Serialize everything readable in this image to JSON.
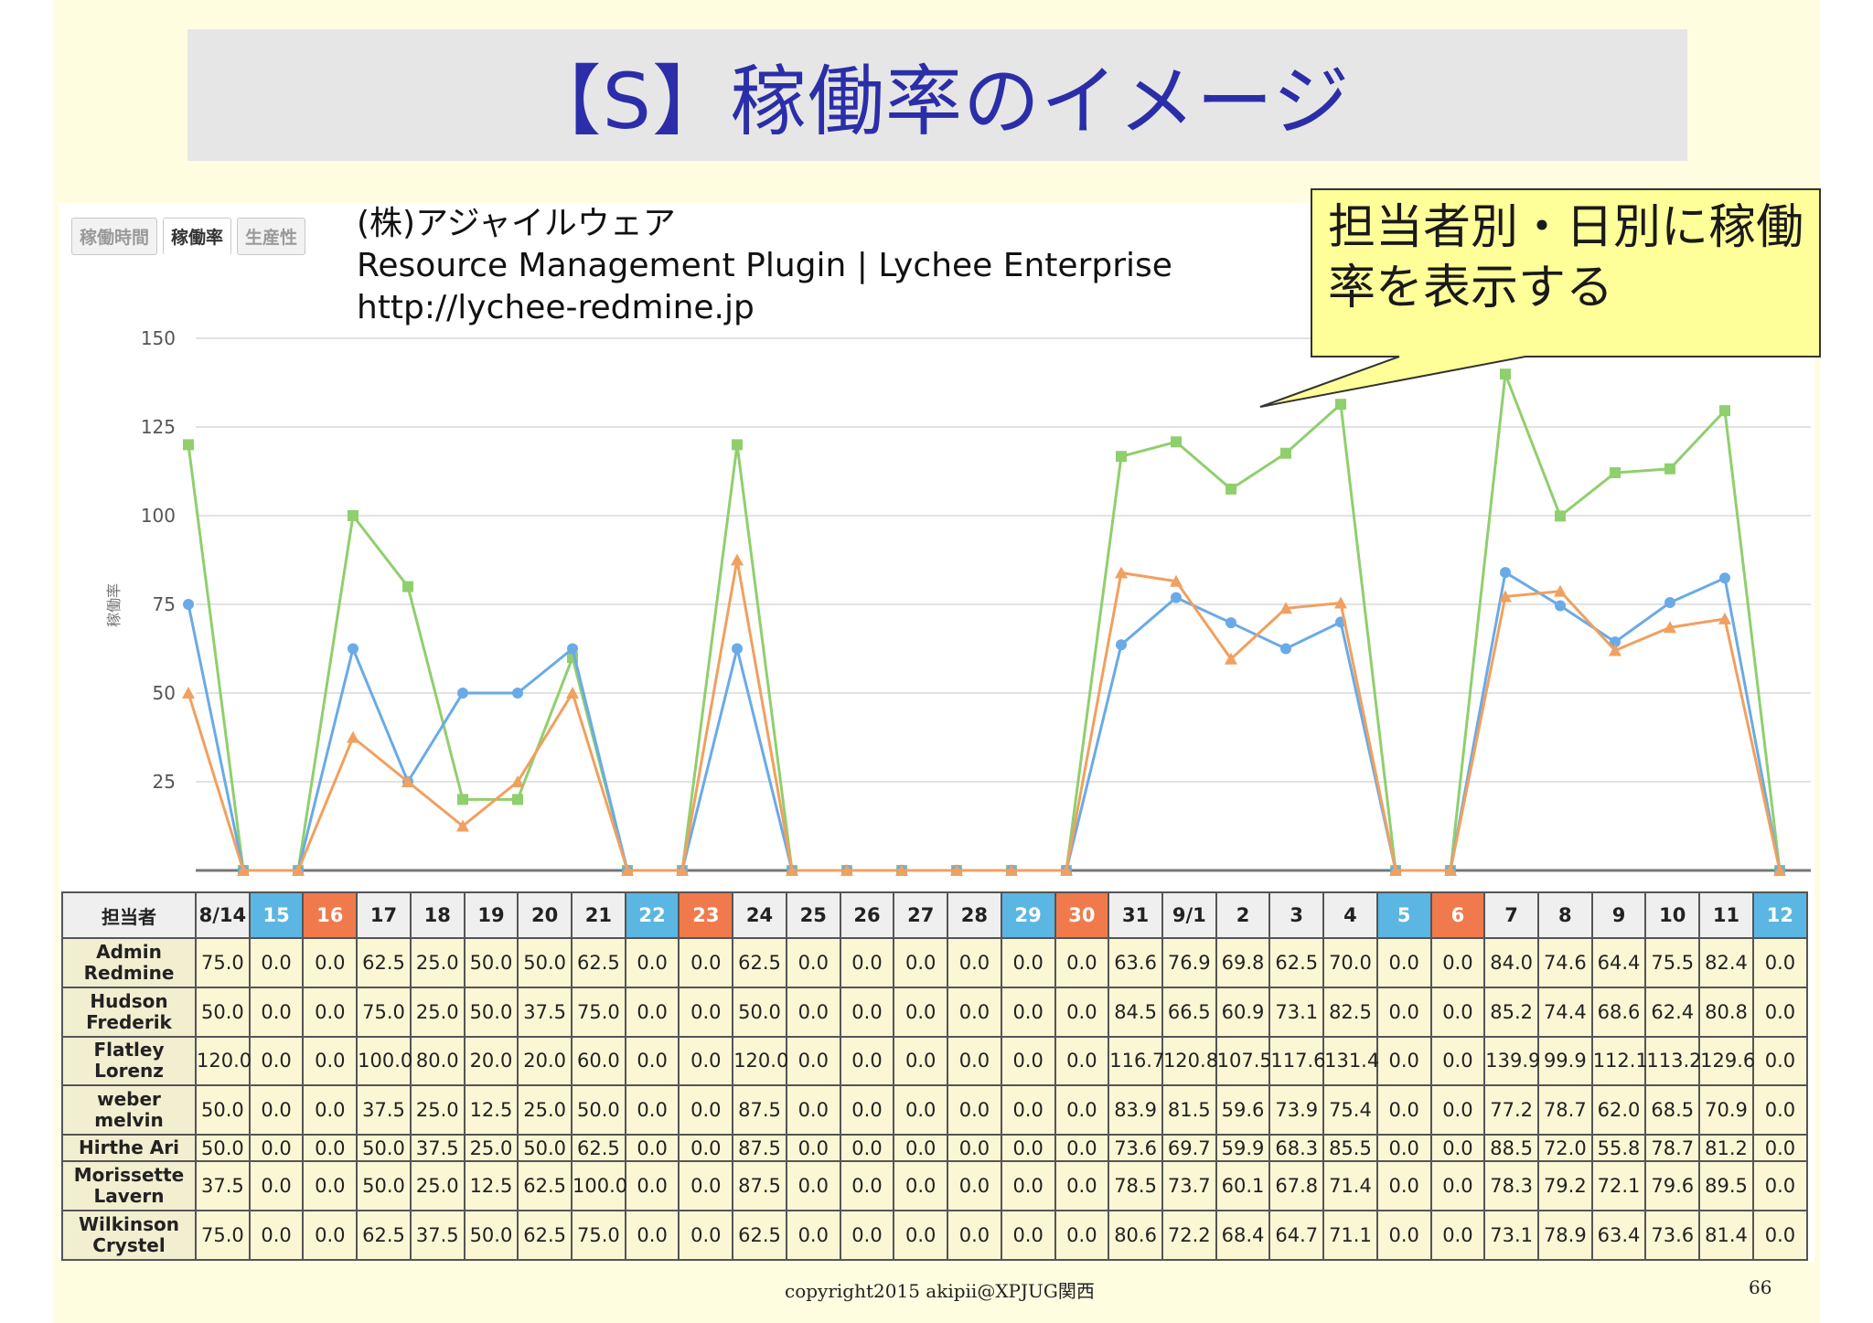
{
  "slide": {
    "title": "【S】稼働率のイメージ",
    "credit_line1": "(株)アジャイルウェア",
    "credit_line2": "Resource Management Plugin | Lychee Enterprise",
    "credit_line3": "http://lychee-redmine.jp",
    "callout": "担当者別・日別に稼働率を表示する",
    "footer_copyright": "copyright2015 akipii@XPJUG関西",
    "page_number": "66"
  },
  "tabs": [
    {
      "label": "稼働時間",
      "active": false
    },
    {
      "label": "稼働率",
      "active": true
    },
    {
      "label": "生産性",
      "active": false
    }
  ],
  "table": {
    "corner_label": "担当者",
    "day_headers": [
      {
        "label": "8/14",
        "type": "weekday"
      },
      {
        "label": "15",
        "type": "saturday"
      },
      {
        "label": "16",
        "type": "sunday"
      },
      {
        "label": "17",
        "type": "weekday"
      },
      {
        "label": "18",
        "type": "weekday"
      },
      {
        "label": "19",
        "type": "weekday"
      },
      {
        "label": "20",
        "type": "weekday"
      },
      {
        "label": "21",
        "type": "weekday"
      },
      {
        "label": "22",
        "type": "saturday"
      },
      {
        "label": "23",
        "type": "sunday"
      },
      {
        "label": "24",
        "type": "weekday"
      },
      {
        "label": "25",
        "type": "weekday"
      },
      {
        "label": "26",
        "type": "weekday"
      },
      {
        "label": "27",
        "type": "weekday"
      },
      {
        "label": "28",
        "type": "weekday"
      },
      {
        "label": "29",
        "type": "saturday"
      },
      {
        "label": "30",
        "type": "sunday"
      },
      {
        "label": "31",
        "type": "weekday"
      },
      {
        "label": "9/1",
        "type": "weekday"
      },
      {
        "label": "2",
        "type": "weekday"
      },
      {
        "label": "3",
        "type": "weekday"
      },
      {
        "label": "4",
        "type": "weekday"
      },
      {
        "label": "5",
        "type": "saturday"
      },
      {
        "label": "6",
        "type": "sunday"
      },
      {
        "label": "7",
        "type": "weekday"
      },
      {
        "label": "8",
        "type": "weekday"
      },
      {
        "label": "9",
        "type": "weekday"
      },
      {
        "label": "10",
        "type": "weekday"
      },
      {
        "label": "11",
        "type": "weekday"
      },
      {
        "label": "12",
        "type": "saturday"
      }
    ],
    "rows": [
      {
        "name": "Admin Redmine",
        "values": [
          "75.0",
          "0.0",
          "0.0",
          "62.5",
          "25.0",
          "50.0",
          "50.0",
          "62.5",
          "0.0",
          "0.0",
          "62.5",
          "0.0",
          "0.0",
          "0.0",
          "0.0",
          "0.0",
          "0.0",
          "63.6",
          "76.9",
          "69.8",
          "62.5",
          "70.0",
          "0.0",
          "0.0",
          "84.0",
          "74.6",
          "64.4",
          "75.5",
          "82.4",
          "0.0"
        ]
      },
      {
        "name": "Hudson Frederik",
        "values": [
          "50.0",
          "0.0",
          "0.0",
          "75.0",
          "25.0",
          "50.0",
          "37.5",
          "75.0",
          "0.0",
          "0.0",
          "50.0",
          "0.0",
          "0.0",
          "0.0",
          "0.0",
          "0.0",
          "0.0",
          "84.5",
          "66.5",
          "60.9",
          "73.1",
          "82.5",
          "0.0",
          "0.0",
          "85.2",
          "74.4",
          "68.6",
          "62.4",
          "80.8",
          "0.0"
        ]
      },
      {
        "name": "Flatley Lorenz",
        "values": [
          "120.0",
          "0.0",
          "0.0",
          "100.0",
          "80.0",
          "20.0",
          "20.0",
          "60.0",
          "0.0",
          "0.0",
          "120.0",
          "0.0",
          "0.0",
          "0.0",
          "0.0",
          "0.0",
          "0.0",
          "116.7",
          "120.8",
          "107.5",
          "117.6",
          "131.4",
          "0.0",
          "0.0",
          "139.9",
          "99.9",
          "112.1",
          "113.2",
          "129.6",
          "0.0"
        ]
      },
      {
        "name": "weber melvin",
        "values": [
          "50.0",
          "0.0",
          "0.0",
          "37.5",
          "25.0",
          "12.5",
          "25.0",
          "50.0",
          "0.0",
          "0.0",
          "87.5",
          "0.0",
          "0.0",
          "0.0",
          "0.0",
          "0.0",
          "0.0",
          "83.9",
          "81.5",
          "59.6",
          "73.9",
          "75.4",
          "0.0",
          "0.0",
          "77.2",
          "78.7",
          "62.0",
          "68.5",
          "70.9",
          "0.0"
        ]
      },
      {
        "name": "Hirthe Ari",
        "values": [
          "50.0",
          "0.0",
          "0.0",
          "50.0",
          "37.5",
          "25.0",
          "50.0",
          "62.5",
          "0.0",
          "0.0",
          "87.5",
          "0.0",
          "0.0",
          "0.0",
          "0.0",
          "0.0",
          "0.0",
          "73.6",
          "69.7",
          "59.9",
          "68.3",
          "85.5",
          "0.0",
          "0.0",
          "88.5",
          "72.0",
          "55.8",
          "78.7",
          "81.2",
          "0.0"
        ]
      },
      {
        "name": "Morissette Lavern",
        "values": [
          "37.5",
          "0.0",
          "0.0",
          "50.0",
          "25.0",
          "12.5",
          "62.5",
          "100.0",
          "0.0",
          "0.0",
          "87.5",
          "0.0",
          "0.0",
          "0.0",
          "0.0",
          "0.0",
          "0.0",
          "78.5",
          "73.7",
          "60.1",
          "67.8",
          "71.4",
          "0.0",
          "0.0",
          "78.3",
          "79.2",
          "72.1",
          "79.6",
          "89.5",
          "0.0"
        ]
      },
      {
        "name": "Wilkinson Crystel",
        "values": [
          "75.0",
          "0.0",
          "0.0",
          "62.5",
          "37.5",
          "50.0",
          "62.5",
          "75.0",
          "0.0",
          "0.0",
          "62.5",
          "0.0",
          "0.0",
          "0.0",
          "0.0",
          "0.0",
          "0.0",
          "80.6",
          "72.2",
          "68.4",
          "64.7",
          "71.1",
          "0.0",
          "0.0",
          "73.1",
          "78.9",
          "63.4",
          "73.6",
          "81.4",
          "0.0"
        ]
      }
    ]
  },
  "chart_data": {
    "type": "line",
    "ylabel": "稼働率",
    "ylim": [
      0,
      150
    ],
    "yticks": [
      25,
      50,
      75,
      100,
      125,
      150
    ],
    "grid": true,
    "categories": [
      "8/14",
      "15",
      "16",
      "17",
      "18",
      "19",
      "20",
      "21",
      "22",
      "23",
      "24",
      "25",
      "26",
      "27",
      "28",
      "29",
      "30",
      "31",
      "9/1",
      "2",
      "3",
      "4",
      "5",
      "6",
      "7",
      "8",
      "9",
      "10",
      "11",
      "12"
    ],
    "series": [
      {
        "color": "#8fcf6e",
        "marker": "square",
        "values": [
          120.0,
          0,
          0,
          100.0,
          80.0,
          20.0,
          20.0,
          60.0,
          0,
          0,
          120.0,
          0,
          0,
          0,
          0,
          0,
          0,
          116.7,
          120.8,
          107.5,
          117.6,
          131.4,
          0,
          0,
          139.9,
          99.9,
          112.1,
          113.2,
          129.6,
          0
        ]
      },
      {
        "color": "#6aaae6",
        "marker": "circle",
        "values": [
          75.0,
          0,
          0,
          62.5,
          25.0,
          50.0,
          50.0,
          62.5,
          0,
          0,
          62.5,
          0,
          0,
          0,
          0,
          0,
          0,
          63.6,
          76.9,
          69.8,
          62.5,
          70.0,
          0,
          0,
          84.0,
          74.6,
          64.4,
          75.5,
          82.4,
          0
        ]
      },
      {
        "color": "#f0a060",
        "marker": "triangle",
        "values": [
          50.0,
          0,
          0,
          37.5,
          25.0,
          12.5,
          25.0,
          50.0,
          0,
          0,
          87.5,
          0,
          0,
          0,
          0,
          0,
          0,
          83.9,
          81.5,
          59.6,
          73.9,
          75.4,
          0,
          0,
          77.2,
          78.7,
          62.0,
          68.5,
          70.9,
          0
        ]
      }
    ]
  }
}
